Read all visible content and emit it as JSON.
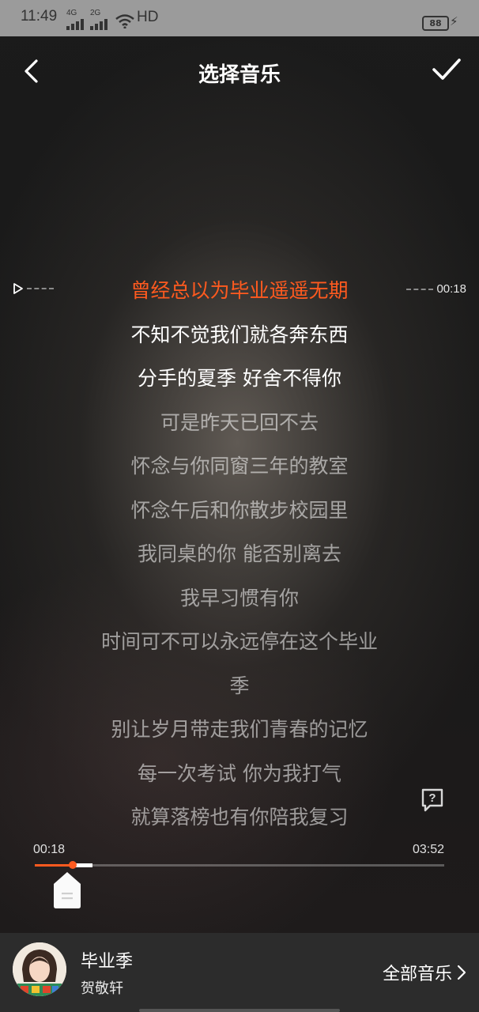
{
  "status_bar": {
    "time": "11:49",
    "net1": "4G",
    "net2": "2G",
    "network": "HD",
    "battery": "88"
  },
  "header": {
    "title": "选择音乐",
    "back_icon": "chevron-left-icon",
    "confirm_icon": "check-icon"
  },
  "marker": {
    "play_icon": "play-outline-icon",
    "time": "00:18"
  },
  "lyrics": [
    "曾经总以为毕业遥遥无期",
    "不知不觉我们就各奔东西",
    "分手的夏季 好舍不得你",
    "可是昨天已回不去",
    "怀念与你同窗三年的教室",
    "怀念午后和你散步校园里",
    "我同桌的你 能否别离去",
    "我早习惯有你",
    "时间可不可以永远停在这个毕业",
    "季",
    "别让岁月带走我们青春的记忆",
    "每一次考试 你为我打气",
    "就算落榜也有你陪我复习"
  ],
  "current_lyric_index": 0,
  "progress": {
    "current": "00:18",
    "total": "03:52",
    "played_fraction": 0.092,
    "selection_end_fraction": 0.14
  },
  "player": {
    "song": "毕业季",
    "artist": "贺敬轩",
    "all_music": "全部音乐"
  },
  "colors": {
    "accent": "#ff5a1f"
  }
}
